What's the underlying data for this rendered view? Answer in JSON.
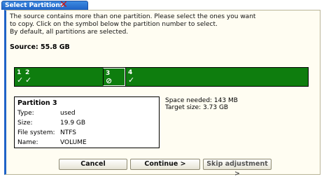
{
  "window": {
    "tab_title": "Select Partitions",
    "close_glyph": "✕"
  },
  "intro": {
    "line1": "The source contains more than one partition. Please select the ones you want",
    "line2": "to copy. Click on the symbol below the partition number to select.",
    "line3": "By default, all partitions are selected."
  },
  "source": {
    "label": "Source: 55.8 GB"
  },
  "partitions": [
    {
      "number": "1",
      "state": "selected",
      "mark": "✓"
    },
    {
      "number": "2",
      "state": "selected",
      "mark": "✓"
    },
    {
      "number": "3",
      "state": "excluded",
      "mark": "⊘"
    },
    {
      "number": "4",
      "state": "selected",
      "mark": "✓"
    }
  ],
  "details": {
    "title": "Partition 3",
    "type_label": "Type:",
    "type_value": "used",
    "size_label": "Size:",
    "size_value": "19.9 GB",
    "fs_label": "File system:",
    "fs_value": "NTFS",
    "name_label": "Name:",
    "name_value": "VOLUME"
  },
  "summary": {
    "space_needed": "Space needed: 143 MB",
    "target_size": "Target size: 3.73 GB"
  },
  "buttons": {
    "cancel": "Cancel",
    "continue": "Continue >",
    "skip": "Skip adjustment >"
  },
  "colors": {
    "partition_bar": "#0e7d0e",
    "tab_blue": "#1f63c7",
    "panel_bg": "#fffdf2"
  }
}
